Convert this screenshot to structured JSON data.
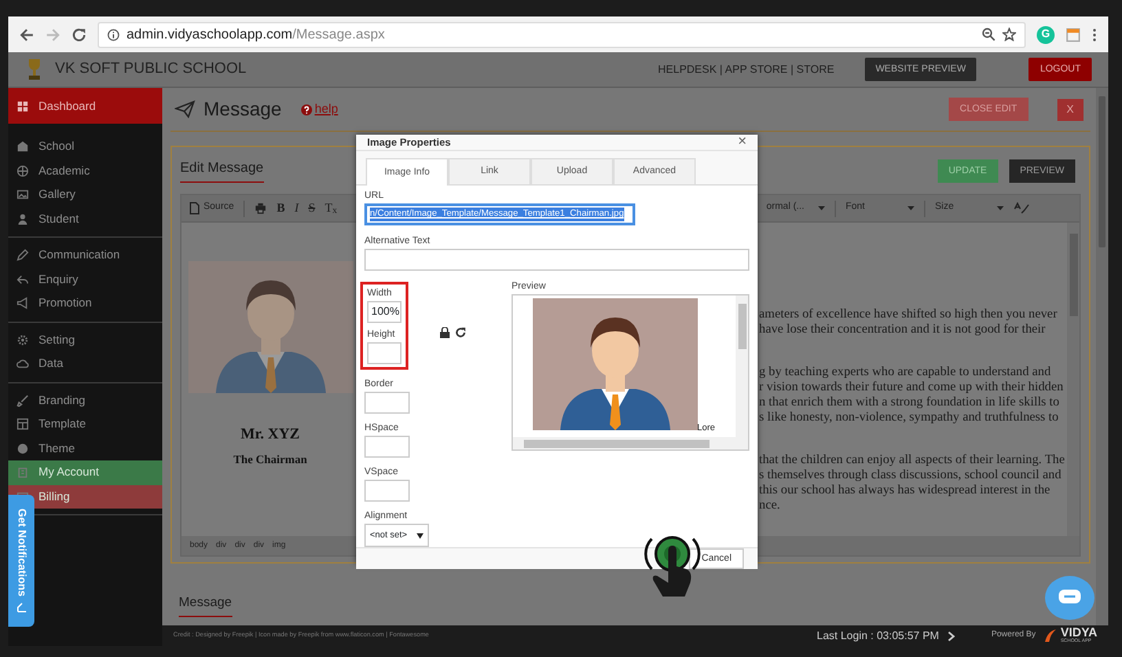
{
  "browser": {
    "url_host": "admin.vidyaschoolapp.com",
    "url_path": "/Message.aspx",
    "extension_letter": "G"
  },
  "header": {
    "school_name": "VK SOFT PUBLIC SCHOOL",
    "links": "HELPDESK | APP STORE | STORE",
    "website_preview": "WEBSITE PREVIEW",
    "logout": "LOGOUT"
  },
  "sidebar": {
    "groups": [
      [
        {
          "label": "Dashboard",
          "selected": true
        }
      ],
      [
        {
          "label": "School",
          "selected": false
        },
        {
          "label": "Academic",
          "selected": false
        },
        {
          "label": "Gallery",
          "selected": false
        },
        {
          "label": "Student",
          "selected": false
        }
      ],
      [
        {
          "label": "Communication",
          "selected": false
        },
        {
          "label": "Enquiry",
          "selected": false
        },
        {
          "label": "Promotion",
          "selected": false
        }
      ],
      [
        {
          "label": "Setting",
          "selected": false
        },
        {
          "label": "Data",
          "selected": false
        }
      ],
      [
        {
          "label": "Branding",
          "selected": false
        },
        {
          "label": "Template",
          "selected": false
        },
        {
          "label": "Theme",
          "selected": false
        },
        {
          "label": "My Account",
          "selected": false,
          "color": "#3b7a48"
        },
        {
          "label": "Billing",
          "selected": false,
          "color": "#8e3b3b"
        }
      ]
    ]
  },
  "page": {
    "title": "Message",
    "help": "help",
    "close_edit": "CLOSE EDIT",
    "close": "X"
  },
  "editor": {
    "heading": "Edit Message",
    "update": "UPDATE",
    "preview": "PREVIEW",
    "toolbar": {
      "source": "Source",
      "buttons": [
        {
          "kind": "bold",
          "label": "B"
        },
        {
          "kind": "italic",
          "label": "I"
        },
        {
          "kind": "strike",
          "label": "S"
        },
        {
          "kind": "clear",
          "label": "T$_{x}$"
        }
      ],
      "format": "ormal (...",
      "font": "Font",
      "size": "Size"
    },
    "caption_name": "Mr. XYZ",
    "caption_role": "The Chairman",
    "paragraphs": [
      [
        "ameters of excellence have shifted so high then you never",
        "have lose their concentration and it is not good for their"
      ],
      [
        "g by teaching experts who are capable to understand and",
        "r vision towards their future and come up with their hidden",
        "n that enrich them with a strong foundation in life skills to",
        "s like honesty, non-violence, sympathy and truthfulness to"
      ],
      [
        "that the children can enjoy all aspects of their learning. The",
        "s themselves through class discussions, school council and",
        "this our school has always has widespread interest in the",
        "nce."
      ]
    ],
    "path": [
      "body",
      "div",
      "div",
      "div",
      "img"
    ]
  },
  "dialog": {
    "title": "Image Properties",
    "close": "×",
    "tabs": [
      {
        "label": "Image Info",
        "selected": true
      },
      {
        "label": "Link",
        "selected": false
      },
      {
        "label": "Upload",
        "selected": false
      },
      {
        "label": "Advanced",
        "selected": false
      }
    ],
    "url_label": "URL",
    "url_value": "n/Content/Image_Template/Message_Template1_Chairman.jpg",
    "url_selected": true,
    "alt_label": "Alternative Text",
    "width_label": "Width",
    "width_value": "100%",
    "height_label": "Height",
    "size_highlighted": true,
    "border_label": "Border",
    "hspace_label": "HSpace",
    "vspace_label": "VSpace",
    "alignment_label": "Alignment",
    "alignment_value": "<not set>",
    "preview_label": "Preview",
    "preview_text": "Lore",
    "cancel": "Cancel"
  },
  "lower": {
    "heading": "Message"
  },
  "footer": {
    "credit": "Credit : Designed by Freepik | Icon made by Freepik from www.flaticon.com | Fontawesome",
    "last_login": "Last Login : 03:05:57 PM",
    "powered_by": "Powered By",
    "logo_text": "VIDYA",
    "logo_subtext": "SCHOOL APP"
  },
  "notifications": {
    "label": "Get Notifications"
  }
}
